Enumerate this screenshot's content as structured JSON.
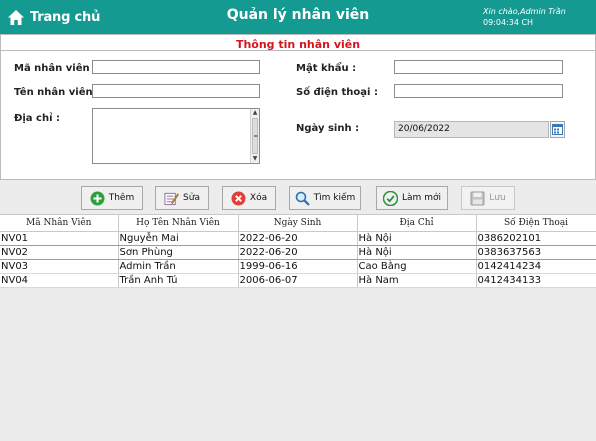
{
  "header": {
    "home_label": "Trang chủ",
    "title": "Quản lý nhân viên",
    "greeting": "Xin chào,Admin Trần",
    "time": "09:04:34 CH",
    "background": "#159a92"
  },
  "form": {
    "section_title": "Thông tin nhân viên",
    "title_color": "#d4151d",
    "fields": {
      "employee_id": {
        "label": "Mã nhân viên :",
        "value": ""
      },
      "employee_name": {
        "label": "Tên nhân viên :",
        "value": ""
      },
      "address": {
        "label": "Địa chỉ :",
        "value": ""
      },
      "password": {
        "label": "Mật khẩu :",
        "value": ""
      },
      "phone": {
        "label": "Số điện thoại :",
        "value": ""
      },
      "birthdate": {
        "label": "Ngày sinh :",
        "value": "20/06/2022"
      }
    }
  },
  "toolbar": {
    "add_label": "Thêm",
    "edit_label": "Sửa",
    "delete_label": "Xóa",
    "search_label": "Tìm kiếm",
    "refresh_label": "Làm mới",
    "save_label": "Lưu"
  },
  "table": {
    "columns": [
      "Mã Nhân Viên",
      "Họ Tên Nhân Viên",
      "Ngày Sinh",
      "Địa Chỉ",
      "Số Điện Thoại"
    ],
    "rows": [
      [
        "NV01",
        "Nguyễn Mai",
        "2022-06-20",
        "Hà Nội",
        "0386202101"
      ],
      [
        "NV02",
        "Sơn Phùng",
        "2022-06-20",
        "Hà Nội",
        "0383637563"
      ],
      [
        "NV03",
        "Admin Trần",
        "1999-06-16",
        "Cao Bằng",
        "0142414234"
      ],
      [
        "NV04",
        "Trần Anh Tú",
        "2006-06-07",
        "Hà Nam",
        "0412434133"
      ]
    ]
  }
}
